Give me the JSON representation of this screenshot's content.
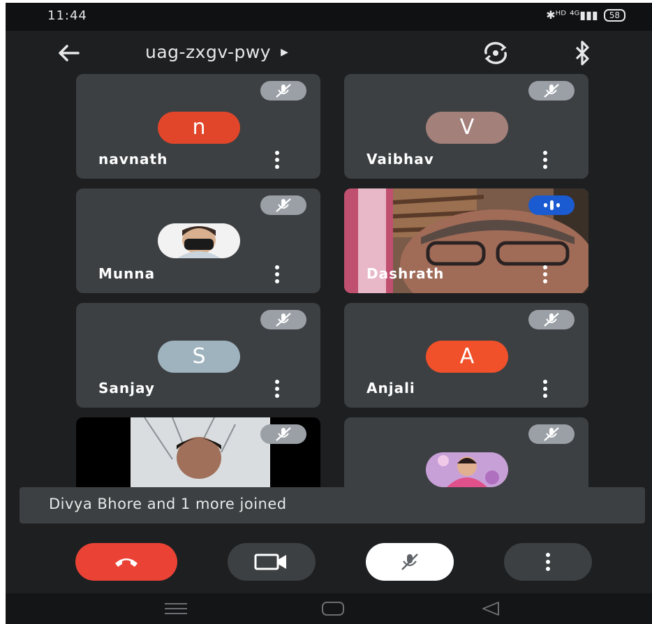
{
  "status_bar": {
    "time": "11:44",
    "network": "✱ᴴᴰ ⁴ᴳ▮▮▮",
    "battery": "58"
  },
  "header": {
    "meeting_code": "uag-zxgv-pwy"
  },
  "participants": [
    {
      "name": "navnath",
      "initial": "n",
      "avatar_color": "#e1462a",
      "audio": "muted"
    },
    {
      "name": "Vaibhav",
      "initial": "V",
      "avatar_color": "#a4807a",
      "audio": "muted"
    },
    {
      "name": "Munna",
      "avatar_type": "photo",
      "audio": "muted"
    },
    {
      "name": "Dashrath",
      "video": "on",
      "audio": "speaking"
    },
    {
      "name": "Sanjay",
      "initial": "S",
      "avatar_color": "#9fb3be",
      "audio": "muted"
    },
    {
      "name": "Anjali",
      "initial": "A",
      "avatar_color": "#f0512a",
      "audio": "muted"
    },
    {
      "name": "",
      "video": "on",
      "audio": "muted"
    },
    {
      "name": "",
      "avatar_type": "photo",
      "audio": "muted"
    }
  ],
  "toast": {
    "message": "Divya Bhore and 1 more joined"
  },
  "controls": {
    "end_call": {
      "icon": "phone-hangup-icon",
      "color": "#ea4335"
    },
    "camera": {
      "icon": "video-camera-icon"
    },
    "microphone": {
      "icon": "mic-off-icon",
      "state": "muted"
    },
    "more": {
      "icon": "more-options-icon"
    }
  },
  "nav_bar": {
    "items": [
      "recents-icon",
      "home-icon",
      "back-icon"
    ]
  }
}
